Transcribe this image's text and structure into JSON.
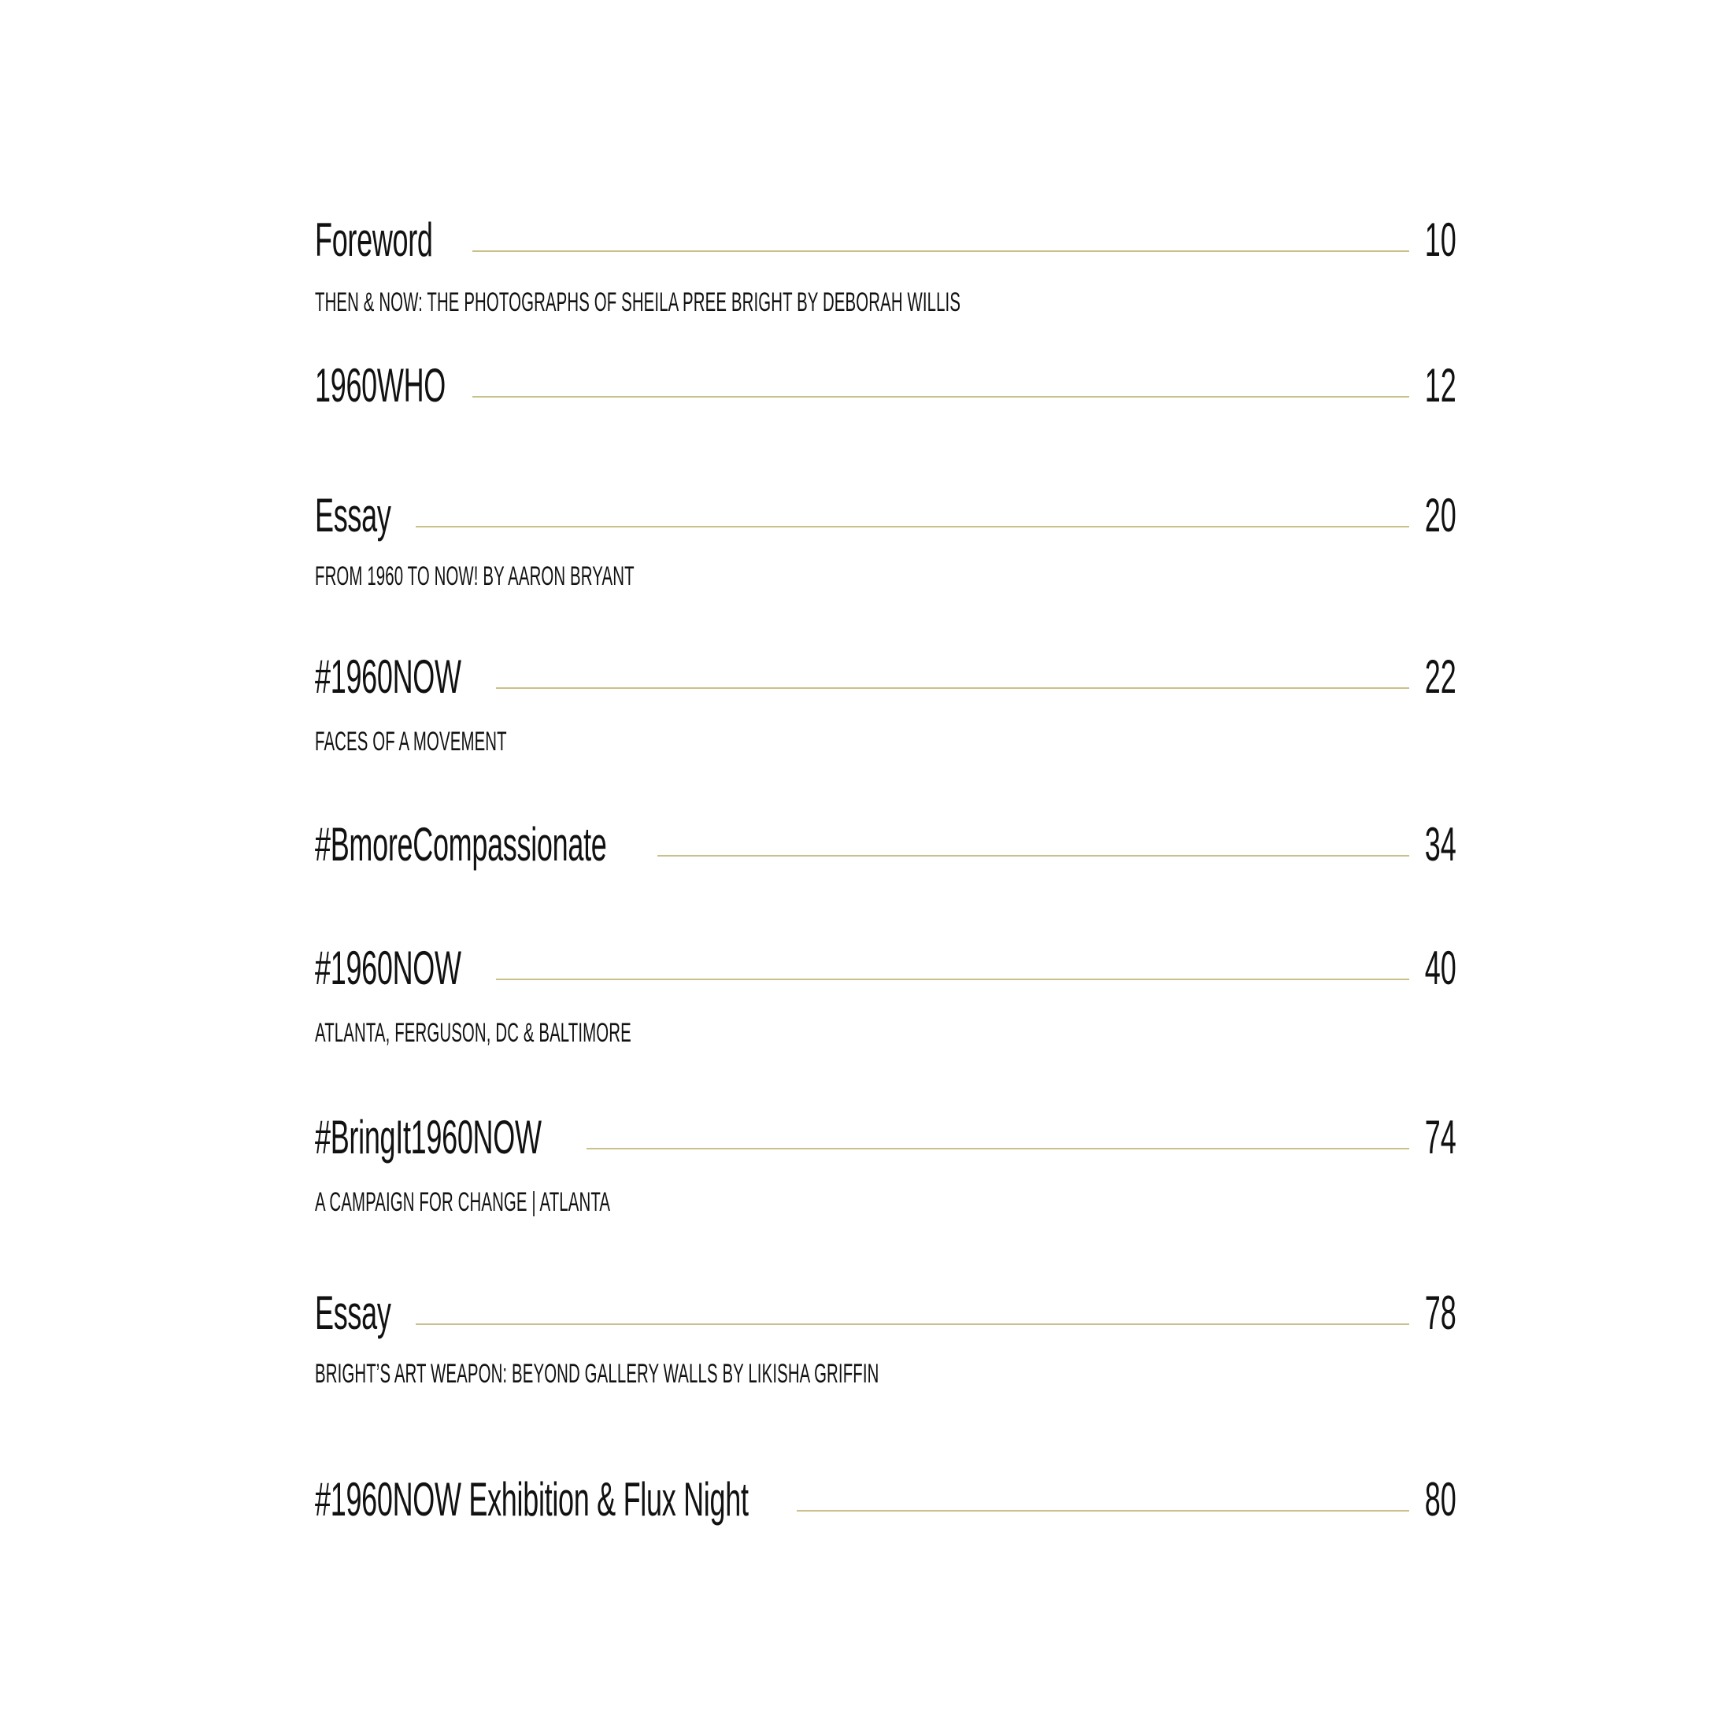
{
  "toc": {
    "entries": [
      {
        "title": "Foreword",
        "page": "10",
        "subtitle": "THEN & NOW: THE PHOTOGRAPHS OF SHEILA PREE BRIGHT  BY DEBORAH WILLIS"
      },
      {
        "title": "1960WHO",
        "page": "12",
        "subtitle": ""
      },
      {
        "title": "Essay",
        "page": "20",
        "subtitle": "FROM 1960 TO NOW! BY AARON BRYANT"
      },
      {
        "title": "#1960NOW",
        "page": "22",
        "subtitle": "FACES OF A MOVEMENT"
      },
      {
        "title": "#BmoreCompassionate",
        "page": "34",
        "subtitle": ""
      },
      {
        "title": "#1960NOW",
        "page": "40",
        "subtitle": "ATLANTA, FERGUSON, DC & BALTIMORE"
      },
      {
        "title": "#BringIt1960NOW",
        "page": "74",
        "subtitle": "A CAMPAIGN FOR CHANGE | ATLANTA"
      },
      {
        "title": "Essay",
        "page": "78",
        "subtitle": "BRIGHT’S ART WEAPON: BEYOND GALLERY WALLS BY LIKISHA GRIFFIN"
      },
      {
        "title": "#1960NOW Exhibition & Flux Night",
        "page": "80",
        "subtitle": ""
      }
    ]
  },
  "colors": {
    "leader": "#c9c08a",
    "text": "#111111",
    "background": "#ffffff"
  }
}
